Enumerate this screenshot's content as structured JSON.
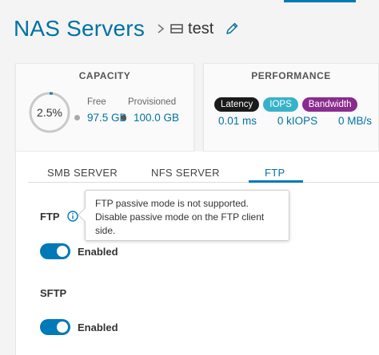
{
  "header": {
    "title": "NAS Servers",
    "server_name": "test"
  },
  "capacity": {
    "title": "CAPACITY",
    "percent_label": "2.5%",
    "percent_used": 0.025,
    "free_label": "Free",
    "free_value": "97.5 GB",
    "provisioned_label": "Provisioned",
    "provisioned_value": "100.0 GB"
  },
  "performance": {
    "title": "PERFORMANCE",
    "badges": [
      {
        "label": "Latency",
        "color": "#1a1a1a"
      },
      {
        "label": "IOPS",
        "color": "#38b2c8"
      },
      {
        "label": "Bandwidth",
        "color": "#8a2b8e"
      }
    ],
    "latency_value": "0.01 ms",
    "iops_value": "0 kIOPS",
    "bandwidth_value": "0 MB/s"
  },
  "tabs": [
    {
      "label": "SMB SERVER"
    },
    {
      "label": "NFS SERVER"
    },
    {
      "label": "FTP",
      "active": true
    }
  ],
  "ftp": {
    "label": "FTP",
    "toggle_label": "Enabled",
    "enabled": true,
    "tooltip": "FTP passive mode is not supported. Disable passive mode on the FTP client side."
  },
  "sftp": {
    "label": "SFTP",
    "toggle_label": "Enabled",
    "enabled": true
  },
  "colors": {
    "accent": "#0079b8",
    "link": "#0072a3"
  }
}
